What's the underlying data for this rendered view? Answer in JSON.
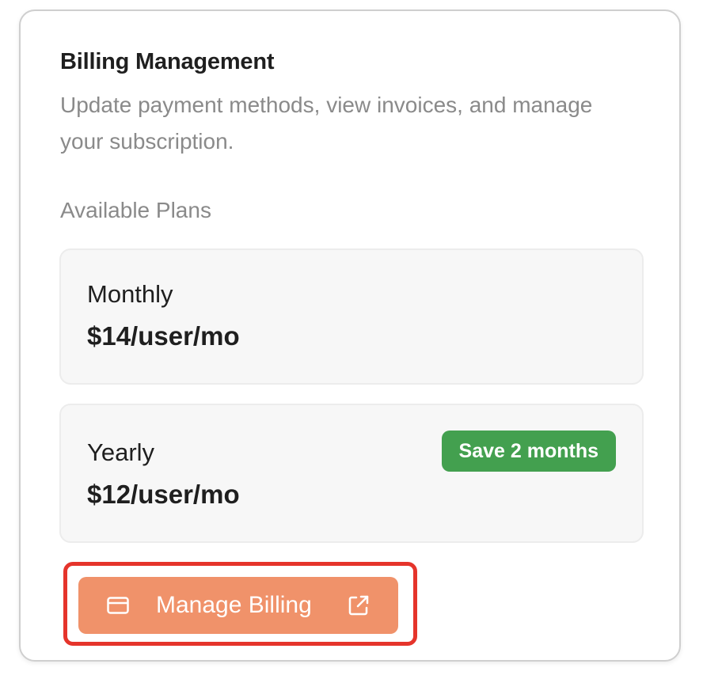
{
  "billing": {
    "title": "Billing Management",
    "subtitle": "Update payment methods, view invoices, and manage your subscription.",
    "section_label": "Available Plans",
    "plans": [
      {
        "name": "Monthly",
        "price": "$14/user/mo",
        "badge": ""
      },
      {
        "name": "Yearly",
        "price": "$12/user/mo",
        "badge": "Save 2 months"
      }
    ],
    "manage_button": {
      "label": "Manage Billing",
      "icon": "credit-card-icon",
      "trailing_icon": "external-link-icon"
    }
  },
  "colors": {
    "accent": "#f0926a",
    "badge": "#43a04f",
    "highlight_outline": "#e5342b"
  }
}
